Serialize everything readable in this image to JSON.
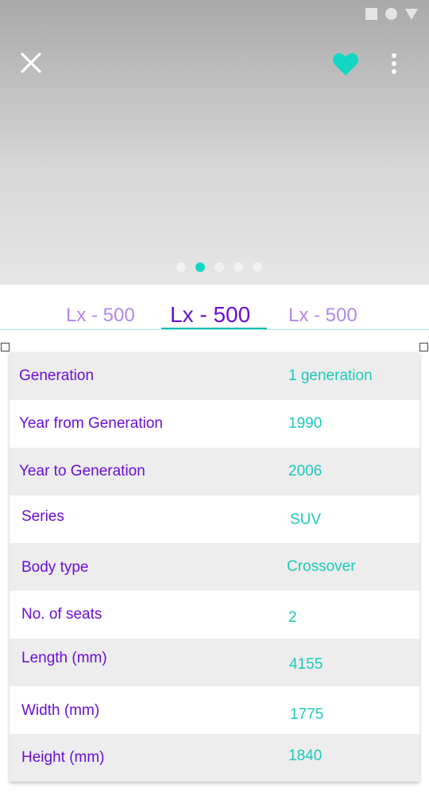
{
  "status_bar": {
    "icons": [
      "square-icon",
      "circle-icon",
      "triangle-icon"
    ]
  },
  "header": {
    "icons": [
      "close-icon",
      "heart-icon",
      "more-vertical-icon"
    ]
  },
  "carousel": {
    "count": 5,
    "active_index": 1
  },
  "tabs": [
    {
      "label": "Lx - 500"
    },
    {
      "label": "Lx - 500"
    },
    {
      "label": "Lx - 500"
    }
  ],
  "active_tab": 1,
  "specs": [
    {
      "label": "Generation",
      "value": "1 generation"
    },
    {
      "label": "Year from Generation",
      "value": "1990"
    },
    {
      "label": "Year to Generation",
      "value": "2006"
    },
    {
      "label": "Series",
      "value": "SUV"
    },
    {
      "label": "Body type",
      "value": "Crossover"
    },
    {
      "label": "No. of seats",
      "value": "2"
    },
    {
      "label": "Length (mm)",
      "value": "4155"
    },
    {
      "label": "Width (mm)",
      "value": "1775"
    },
    {
      "label": "Height (mm)",
      "value": "1840"
    }
  ],
  "colors": {
    "accent": "#13d6c4",
    "primary": "#6a0fd8",
    "tab_inactive": "#b388eb"
  }
}
